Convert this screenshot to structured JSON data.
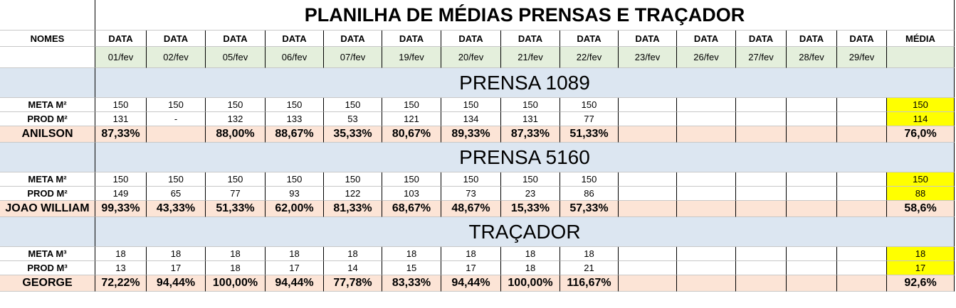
{
  "title": "PLANILHA DE MÉDIAS PRENSAS E TRAÇADOR",
  "header": {
    "names_label": "NOMES",
    "date_label": "DATA",
    "average_label": "MÉDIA",
    "dates": [
      "01/fev",
      "02/fev",
      "05/fev",
      "06/fev",
      "07/fev",
      "19/fev",
      "20/fev",
      "21/fev",
      "22/fev",
      "23/fev",
      "26/fev",
      "27/fev",
      "28/fev",
      "29/fev"
    ]
  },
  "sections": [
    {
      "title": "PRENSA 1089",
      "meta_label": "META M²",
      "prod_label": "PROD M²",
      "operator": "ANILSON",
      "meta": [
        "150",
        "150",
        "150",
        "150",
        "150",
        "150",
        "150",
        "150",
        "150",
        "",
        "",
        "",
        "",
        ""
      ],
      "prod": [
        "131",
        "-",
        "132",
        "133",
        "53",
        "121",
        "134",
        "131",
        "77",
        "",
        "",
        "",
        "",
        ""
      ],
      "pct": [
        "87,33%",
        "",
        "88,00%",
        "88,67%",
        "35,33%",
        "80,67%",
        "89,33%",
        "87,33%",
        "51,33%",
        "",
        "",
        "",
        "",
        ""
      ],
      "meta_avg": "150",
      "prod_avg": "114",
      "pct_avg": "76,0%"
    },
    {
      "title": "PRENSA 5160",
      "meta_label": "META M²",
      "prod_label": "PROD M²",
      "operator": "JOAO WILLIAM",
      "meta": [
        "150",
        "150",
        "150",
        "150",
        "150",
        "150",
        "150",
        "150",
        "150",
        "",
        "",
        "",
        "",
        ""
      ],
      "prod": [
        "149",
        "65",
        "77",
        "93",
        "122",
        "103",
        "73",
        "23",
        "86",
        "",
        "",
        "",
        "",
        ""
      ],
      "pct": [
        "99,33%",
        "43,33%",
        "51,33%",
        "62,00%",
        "81,33%",
        "68,67%",
        "48,67%",
        "15,33%",
        "57,33%",
        "",
        "",
        "",
        "",
        ""
      ],
      "meta_avg": "150",
      "prod_avg": "88",
      "pct_avg": "58,6%"
    },
    {
      "title": "TRAÇADOR",
      "meta_label": "META M³",
      "prod_label": "PROD M³",
      "operator": "GEORGE",
      "meta": [
        "18",
        "18",
        "18",
        "18",
        "18",
        "18",
        "18",
        "18",
        "18",
        "",
        "",
        "",
        "",
        ""
      ],
      "prod": [
        "13",
        "17",
        "18",
        "17",
        "14",
        "15",
        "17",
        "18",
        "21",
        "",
        "",
        "",
        "",
        ""
      ],
      "pct": [
        "72,22%",
        "94,44%",
        "100,00%",
        "94,44%",
        "77,78%",
        "83,33%",
        "94,44%",
        "100,00%",
        "116,67%",
        "",
        "",
        "",
        "",
        ""
      ],
      "meta_avg": "18",
      "prod_avg": "17",
      "pct_avg": "92,6%"
    }
  ],
  "colors": {
    "date_row": "#e4efdc",
    "section_row": "#dce6f1",
    "percent_row": "#fce4d6",
    "average_highlight": "#ffff00"
  }
}
